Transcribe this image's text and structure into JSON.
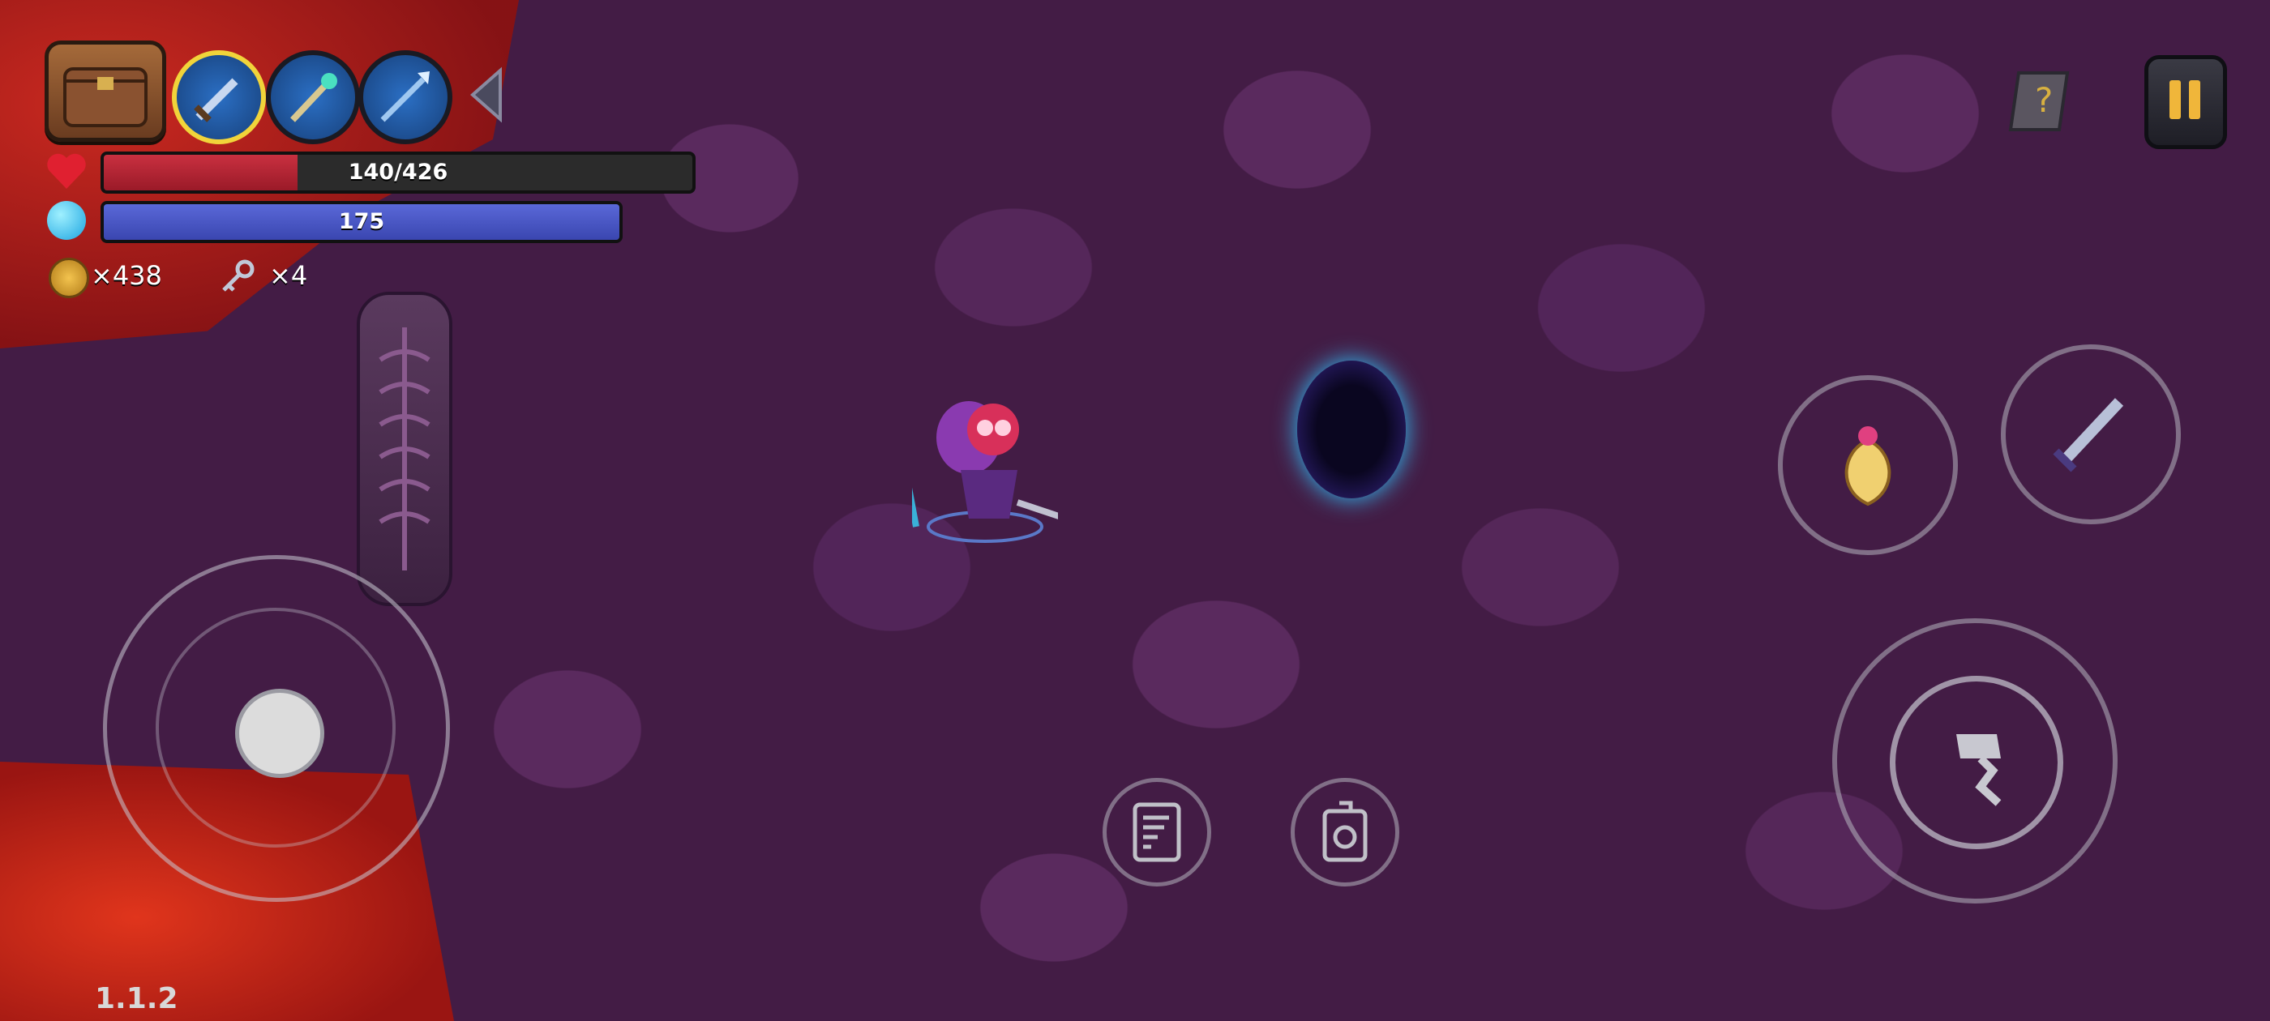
{
  "hud": {
    "bag_icon": "satchel-icon",
    "weapon_slots": [
      {
        "icon": "sword-icon",
        "active": true
      },
      {
        "icon": "staff-icon",
        "active": false
      },
      {
        "icon": "spear-icon",
        "active": false
      }
    ],
    "collapse_icon": "chevron-left-icon",
    "health": {
      "current": 140,
      "max": 426,
      "text": "140/426",
      "color": "#c93040"
    },
    "mana": {
      "text": "175",
      "color": "#4a56c8"
    },
    "coins": {
      "icon": "coin-icon",
      "text": "×438"
    },
    "keys": {
      "icon": "key-icon",
      "text": "×4"
    },
    "help_icon": "question-book-icon",
    "pause_icon": "pause-icon"
  },
  "controls": {
    "joystick_icon": "joystick-icon",
    "skill_icon": "potion-icon",
    "weapon_switch_icon": "sword-icon",
    "attack_icon": "hammer-icon",
    "task_icon": "scroll-icon",
    "inventory_icon": "backpack-icon"
  },
  "scene": {
    "portal_color": "#2ec6ff",
    "lava_color": "#d12a1e",
    "floor_color": "#431c45"
  },
  "footer": {
    "version": "1.1.2"
  }
}
